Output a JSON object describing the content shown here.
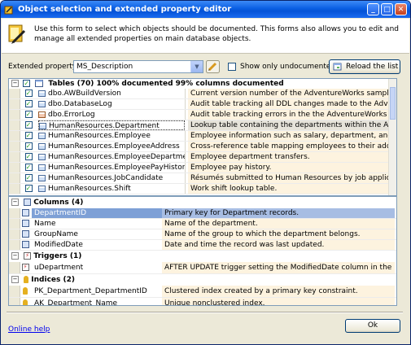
{
  "window": {
    "title": "Object selection and extended property editor"
  },
  "header": {
    "description": "Use this form to select which objects should be documented. This forms also allows you to edit and manage all extended properties on main database objects."
  },
  "toolbar": {
    "extended_property_label": "Extended property:",
    "extended_property_value": "MS_Description",
    "show_undocumented_label": "Show only undocumented objects",
    "show_undocumented_checked": false,
    "reload_label": "Reload the list"
  },
  "tables": {
    "group_label": "Tables (70) 100% documented 99% columns documented",
    "rows": [
      {
        "checked": true,
        "icon": "table-icon",
        "name": "dbo.AWBuildVersion",
        "description": "Current version number of the AdventureWorks sample database."
      },
      {
        "checked": true,
        "icon": "table-icon",
        "name": "dbo.DatabaseLog",
        "description": "Audit table tracking all DDL changes made to the AdventureWorks..."
      },
      {
        "checked": true,
        "icon": "system-table-icon",
        "name": "dbo.ErrorLog",
        "description": "Audit table tracking errors in the the AdventureWorks databas..."
      },
      {
        "checked": true,
        "icon": "table-icon",
        "name": "HumanResources.Department",
        "description": "Lookup table containing the departments within the Adventure...",
        "selected": true
      },
      {
        "checked": true,
        "icon": "table-icon",
        "name": "HumanResources.Employee",
        "description": "Employee information such as salary, department, and title."
      },
      {
        "checked": true,
        "icon": "table-icon",
        "name": "HumanResources.EmployeeAddress",
        "description": "Cross-reference table mapping employees to their address(es)."
      },
      {
        "checked": true,
        "icon": "table-icon",
        "name": "HumanResources.EmployeeDepartmentHistory",
        "description": "Employee department transfers."
      },
      {
        "checked": true,
        "icon": "table-icon",
        "name": "HumanResources.EmployeePayHistory",
        "description": "Employee pay history."
      },
      {
        "checked": true,
        "icon": "table-icon",
        "name": "HumanResources.JobCandidate",
        "description": "Résumés submitted to Human Resources by job applicants."
      },
      {
        "checked": true,
        "icon": "table-icon",
        "name": "HumanResources.Shift",
        "description": "Work shift lookup table."
      }
    ]
  },
  "details": {
    "columns": {
      "group_label": "Columns (4)",
      "rows": [
        {
          "name": "DepartmentID",
          "description": "Primary key for Department records.",
          "selected": true
        },
        {
          "name": "Name",
          "description": "Name of the department."
        },
        {
          "name": "GroupName",
          "description": "Name of the group to which the department belongs."
        },
        {
          "name": "ModifiedDate",
          "description": "Date and time the record was last updated."
        }
      ]
    },
    "triggers": {
      "group_label": "Triggers (1)",
      "rows": [
        {
          "name": "uDepartment",
          "description": "AFTER UPDATE trigger setting the ModifiedDate column in the Department table to the current..."
        }
      ]
    },
    "indices": {
      "group_label": "Indices (2)",
      "rows": [
        {
          "name": "PK_Department_DepartmentID",
          "description": "Clustered index created by a primary key constraint."
        },
        {
          "name": "AK_Department_Name",
          "description": "Unique nonclustered index."
        }
      ]
    }
  },
  "footer": {
    "online_help": "Online help",
    "ok_label": "Ok"
  },
  "colors": {
    "titlebar": "#0553d6",
    "selected_row": "#7ea0d6",
    "description_cell": "#fdf3df"
  }
}
